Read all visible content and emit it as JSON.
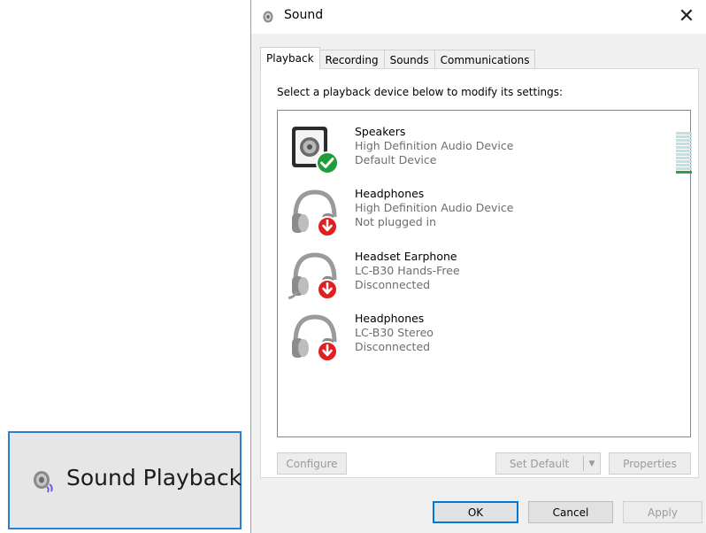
{
  "side_item": {
    "label": "Sound Playback",
    "icon": "speaker-icon"
  },
  "window": {
    "title": "Sound",
    "close_glyph": "✕",
    "tabs": [
      {
        "label": "Playback",
        "active": true
      },
      {
        "label": "Recording",
        "active": false
      },
      {
        "label": "Sounds",
        "active": false
      },
      {
        "label": "Communications",
        "active": false
      }
    ],
    "instruction": "Select a playback device below to modify its settings:",
    "devices": [
      {
        "name": "Speakers",
        "description": "High Definition Audio Device",
        "status": "Default Device",
        "icon": "speaker-icon",
        "badge": "check-badge"
      },
      {
        "name": "Headphones",
        "description": "High Definition Audio Device",
        "status": "Not plugged in",
        "icon": "headphones-icon",
        "badge": "down-arrow-badge"
      },
      {
        "name": "Headset Earphone",
        "description": "LC-B30 Hands-Free",
        "status": "Disconnected",
        "icon": "headset-icon",
        "badge": "down-arrow-badge"
      },
      {
        "name": "Headphones",
        "description": "LC-B30 Stereo",
        "status": "Disconnected",
        "icon": "headphones-icon",
        "badge": "down-arrow-badge"
      }
    ],
    "buttons": {
      "configure": "Configure",
      "set_default": "Set Default",
      "properties": "Properties",
      "ok": "OK",
      "cancel": "Cancel",
      "apply": "Apply"
    },
    "colors": {
      "accent": "#0078d7",
      "default_check": "#1f9d3a",
      "disconnected": "#e02020",
      "side_border": "#2a7fd0"
    }
  }
}
